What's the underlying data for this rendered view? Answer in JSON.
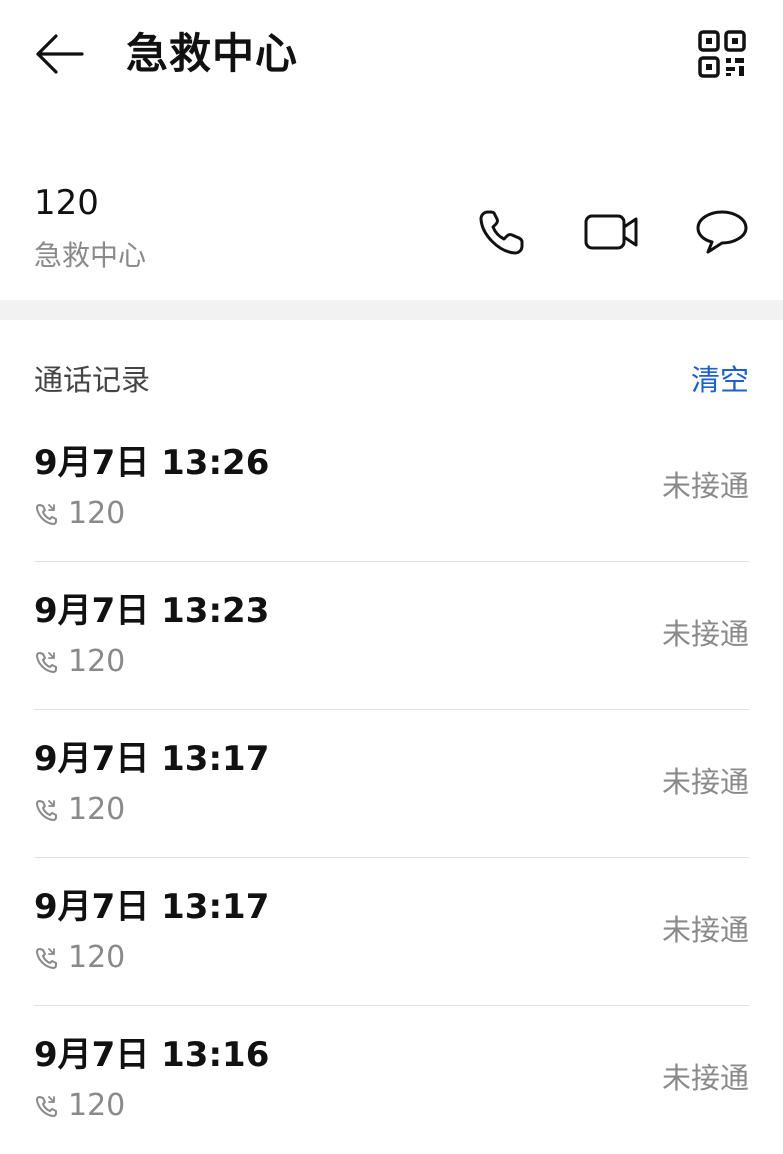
{
  "header": {
    "title": "急救中心",
    "back_icon": "back-arrow-icon",
    "qr_icon": "qr-code-icon"
  },
  "contact": {
    "number": "120",
    "name": "急救中心",
    "actions": [
      {
        "name": "call",
        "icon": "phone-icon"
      },
      {
        "name": "video",
        "icon": "video-camera-icon"
      },
      {
        "name": "message",
        "icon": "message-bubble-icon"
      }
    ]
  },
  "call_log": {
    "title": "通话记录",
    "clear_label": "清空",
    "entries": [
      {
        "time": "9月7日 13:26",
        "number": "120",
        "status": "未接通"
      },
      {
        "time": "9月7日 13:23",
        "number": "120",
        "status": "未接通"
      },
      {
        "time": "9月7日 13:17",
        "number": "120",
        "status": "未接通"
      },
      {
        "time": "9月7日 13:17",
        "number": "120",
        "status": "未接通"
      },
      {
        "time": "9月7日 13:16",
        "number": "120",
        "status": "未接通"
      }
    ]
  },
  "colors": {
    "accent": "#1a5fd6",
    "secondary_text": "#8a8a8a",
    "divider": "#e2e2e2",
    "section_bg": "#f2f2f2"
  }
}
